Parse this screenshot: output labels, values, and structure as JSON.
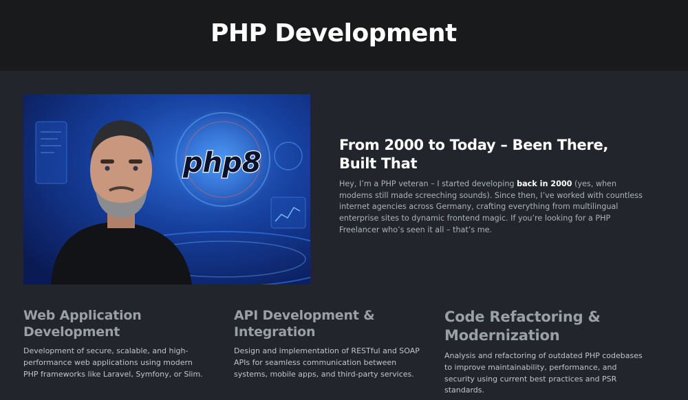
{
  "header": {
    "title": "PHP Development"
  },
  "hero": {
    "image_label": "php8",
    "heading": "From 2000 to Today – Been There, Built That",
    "text_before": "Hey, I’m a PHP veteran – I started developing ",
    "text_strong": "back in 2000",
    "text_after": " (yes, when modems still made screeching sounds). Since then, I’ve worked with countless internet agencies across Germany, crafting everything from multilingual enterprise sites to dynamic frontend magic. If you’re looking for a PHP Freelancer who’s seen it all – that’s me."
  },
  "services": [
    {
      "title": "Web Application Development",
      "text": "Development of secure, scalable, and high-performance web applications using modern PHP frameworks like Laravel, Symfony, or Slim."
    },
    {
      "title": "API Development & Integration",
      "text": "Design and implementation of RESTful and SOAP APIs for seamless communication between systems, mobile apps, and third-party services."
    },
    {
      "title": "Code Refactoring & Modernization",
      "text": "Analysis and refactoring of outdated PHP codebases to improve maintainability, performance, and security using current best practices and PSR standards."
    }
  ]
}
